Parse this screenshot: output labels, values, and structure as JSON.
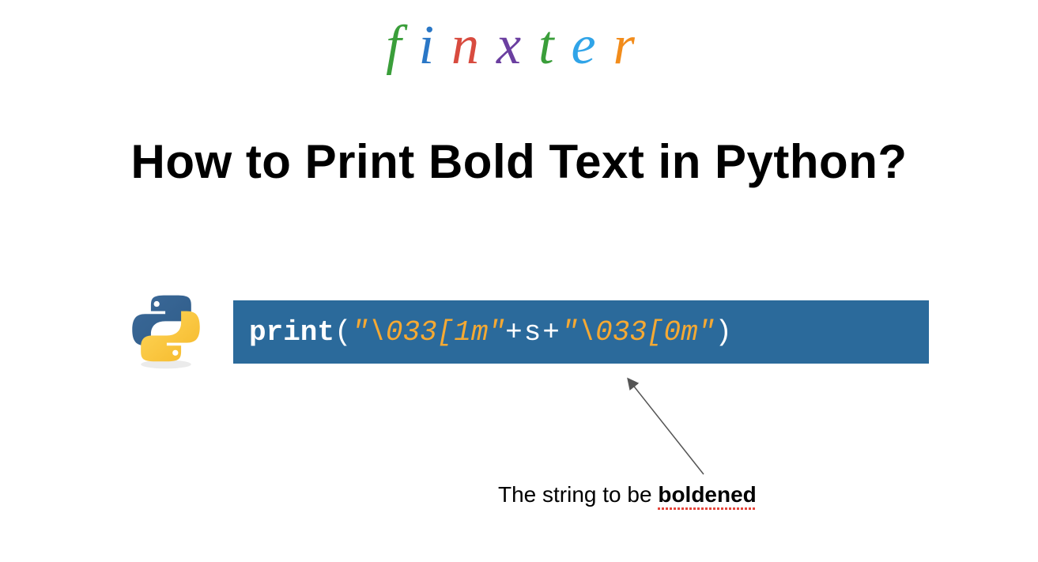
{
  "logo": {
    "letters": [
      "f",
      "i",
      "n",
      "x",
      "t",
      "e",
      "r"
    ]
  },
  "title": {
    "pre": "How to Print ",
    "bold": "Bold",
    "post": " Text in Python?"
  },
  "code": {
    "print_kw": "print",
    "paren_open": "(",
    "str1": "\"\\033[1m\"",
    "op1": " + ",
    "var": "s",
    "op2": " + ",
    "str2": "\"\\033[0m\"",
    "paren_close": ")"
  },
  "annotation": {
    "pre": "The string to be ",
    "bold": "boldened"
  }
}
